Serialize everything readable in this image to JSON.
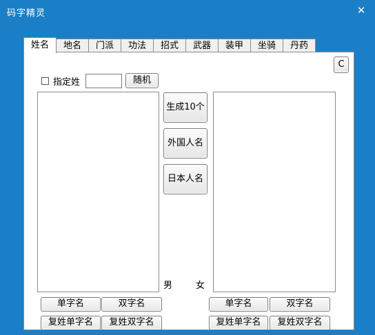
{
  "window": {
    "title": "码字精灵",
    "close_icon": "close-icon"
  },
  "tabs": [
    {
      "label": "姓名",
      "active": true
    },
    {
      "label": "地名",
      "active": false
    },
    {
      "label": "门派",
      "active": false
    },
    {
      "label": "功法",
      "active": false
    },
    {
      "label": "招式",
      "active": false
    },
    {
      "label": "武器",
      "active": false
    },
    {
      "label": "装甲",
      "active": false
    },
    {
      "label": "坐骑",
      "active": false
    },
    {
      "label": "丹药",
      "active": false
    }
  ],
  "surname": {
    "checkbox_label": "指定姓",
    "checked": false,
    "input_value": "",
    "random_button": "随机"
  },
  "c_button": "C",
  "center_buttons": {
    "generate": "生成10个",
    "foreign": "外国人名",
    "japanese": "日本人名"
  },
  "gender": {
    "male": "男",
    "female": "女"
  },
  "male_buttons": {
    "single": "单字名",
    "double": "双字名",
    "compound_single": "复姓单字名",
    "compound_double": "复姓双字名"
  },
  "female_buttons": {
    "single": "单字名",
    "double": "双字名",
    "compound_single": "复姓单字名",
    "compound_double": "复姓双字名"
  },
  "colors": {
    "background": "#1a7fc6",
    "panel": "#ffffff",
    "button": "#eeeeee"
  }
}
